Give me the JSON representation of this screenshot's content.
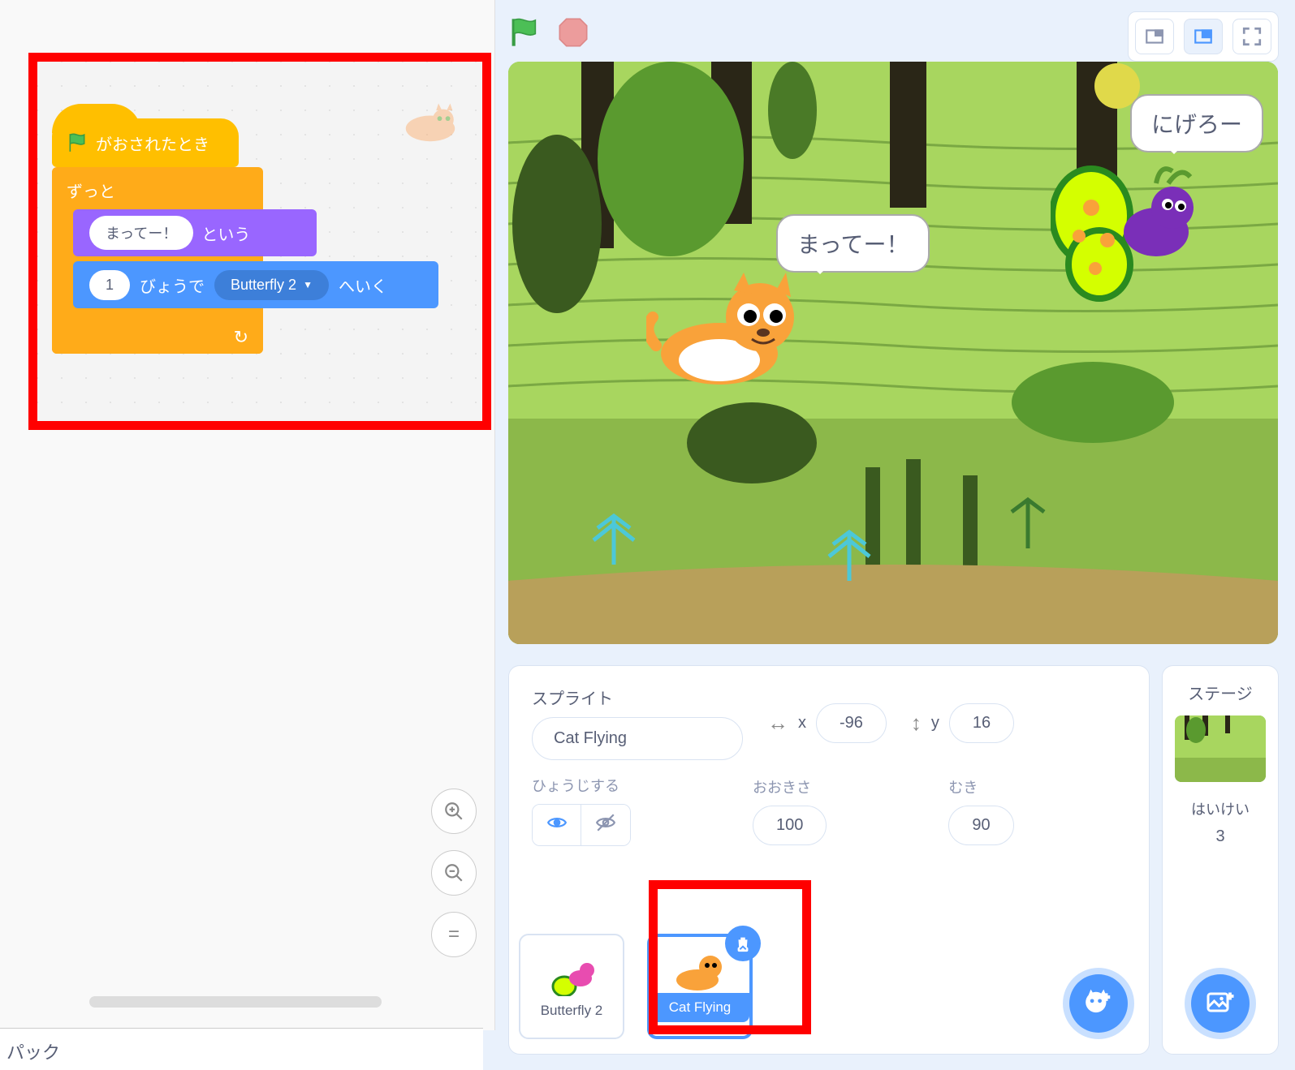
{
  "script": {
    "hat_label": "がおされたとき",
    "forever_label": "ずっと",
    "say_value": "まってー！",
    "say_suffix": "という",
    "glide_seconds": "1",
    "glide_mid": "びょうで",
    "glide_target": "Butterfly 2",
    "glide_suffix": "へいく"
  },
  "backpack_label": "パック",
  "stage_bubbles": {
    "cat": "まってー！",
    "butterfly": "にげろー"
  },
  "sprite_panel": {
    "title": "スプライト",
    "name": "Cat Flying",
    "x_label": "x",
    "x": "-96",
    "y_label": "y",
    "y": "16",
    "show_label": "ひょうじする",
    "size_label": "おおきさ",
    "size": "100",
    "dir_label": "むき",
    "dir": "90"
  },
  "sprites": {
    "0": {
      "name": "Butterfly 2"
    },
    "1": {
      "name": "Cat Flying"
    }
  },
  "stage_right": {
    "title": "ステージ",
    "bkg_label": "はいけい",
    "count": "3"
  }
}
